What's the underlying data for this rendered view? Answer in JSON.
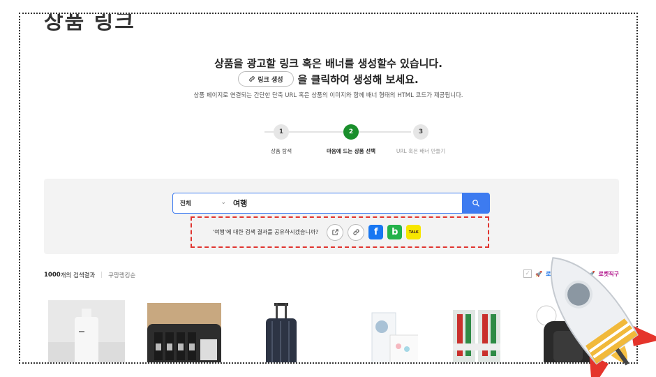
{
  "page": {
    "title": "상품 링크",
    "headline_1": "상품을 광고할 링크 혹은 배너를 생성할수 있습니다.",
    "headline_2_button": "링크 생성",
    "headline_2_suffix": "을 클릭하여 생성해 보세요.",
    "description": "상품 페이지로 연결되는 간단한 단축 URL 혹은 상품의 이미지와 함께 배너 형태의 HTML 코드가 제공됩니다."
  },
  "steps": [
    {
      "number": "1",
      "label": "상품 탐색",
      "state": "done"
    },
    {
      "number": "2",
      "label": "마음에 드는 상품 선택",
      "state": "active"
    },
    {
      "number": "3",
      "label": "URL 혹은 배너 만들기",
      "state": "pending"
    }
  ],
  "search": {
    "category": "전체",
    "query": "여행"
  },
  "share": {
    "prompt": "'여행'에 대한 검색 결과를 공유하시겠습니까?",
    "icons": [
      "external-link-icon",
      "link-icon",
      "facebook-icon",
      "band-icon",
      "kakaotalk-icon"
    ],
    "kakao_label": "TALK"
  },
  "results": {
    "count": "1000",
    "count_suffix": " 개의 검색결과",
    "sort": "쿠팡랭킹순",
    "filters": [
      {
        "label": "로켓배송",
        "checked": false
      },
      {
        "label": "로켓직구",
        "checked": false
      }
    ]
  },
  "products": [
    {
      "name": "white-bottle-product"
    },
    {
      "name": "toiletry-pouch-kit"
    },
    {
      "name": "navy-suitcase"
    },
    {
      "name": "face-mask-pack"
    },
    {
      "name": "toothbrush-set"
    },
    {
      "name": "black-backpack"
    }
  ],
  "colors": {
    "accent_blue": "#3d7bf0",
    "step_active": "#1a8f2c",
    "share_border": "#e0342f",
    "panel_bg": "#f3f3f3"
  }
}
